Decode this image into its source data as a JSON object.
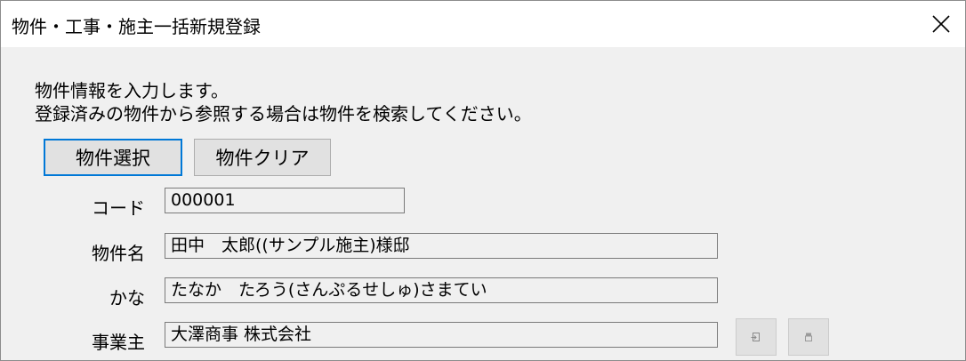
{
  "window": {
    "title": "物件・工事・施主一括新規登録"
  },
  "intro": {
    "line1": "物件情報を入力します。",
    "line2": "登録済みの物件から参照する場合は物件を検索してください。"
  },
  "buttons": {
    "select_label": "物件選択",
    "clear_label": "物件クリア"
  },
  "fields": {
    "code": {
      "label": "コード",
      "value": "000001"
    },
    "name": {
      "label": "物件名",
      "value": "田中　太郎((サンプル施主)様邸"
    },
    "kana": {
      "label": "かな",
      "value": "たなか　たろう(さんぷるせしゅ)さまてい"
    },
    "owner": {
      "label": "事業主",
      "value": "大澤商事 株式会社"
    }
  },
  "icons": {
    "close": "close-icon",
    "owner_action_1": "document-import-icon",
    "owner_action_2": "clear-icon"
  }
}
